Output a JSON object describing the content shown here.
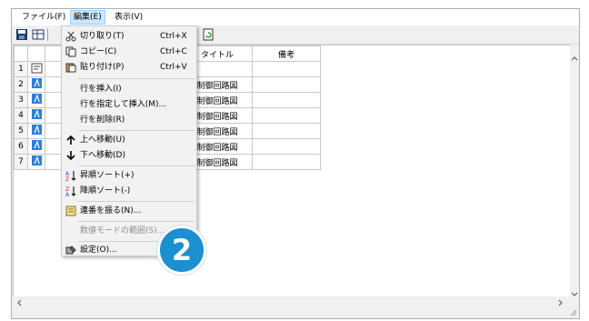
{
  "menubar": {
    "file": "ファイル(F)",
    "edit": "編集(E)",
    "view": "表示(V)"
  },
  "grid": {
    "headers": [
      "タイトル",
      "備考"
    ],
    "rows": [
      {
        "num": "1",
        "title": ""
      },
      {
        "num": "2",
        "title": "制御回路図"
      },
      {
        "num": "3",
        "title": "制御回路図"
      },
      {
        "num": "4",
        "title": "制御回路図"
      },
      {
        "num": "5",
        "title": "制御回路図"
      },
      {
        "num": "6",
        "title": "制御回路図"
      },
      {
        "num": "7",
        "title": "制御回路図"
      }
    ]
  },
  "edit_menu": {
    "cut": {
      "label": "切り取り(T)",
      "shortcut": "Ctrl+X",
      "icon": "scissors-icon"
    },
    "copy": {
      "label": "コピー(C)",
      "shortcut": "Ctrl+C",
      "icon": "copy-icon"
    },
    "paste": {
      "label": "貼り付け(P)",
      "shortcut": "Ctrl+V",
      "icon": "paste-icon"
    },
    "insert_row": {
      "label": "行を挿入(I)"
    },
    "insert_row_at": {
      "label": "行を指定して挿入(M)..."
    },
    "delete_row": {
      "label": "行を削除(R)"
    },
    "move_up": {
      "label": "上へ移動(U)",
      "icon": "arrow-up-icon"
    },
    "move_down": {
      "label": "下へ移動(D)",
      "icon": "arrow-down-icon"
    },
    "sort_asc": {
      "label": "昇順ソート(+)",
      "icon": "sort-ascending-icon"
    },
    "sort_desc": {
      "label": "降順ソート(-)",
      "icon": "sort-descending-icon"
    },
    "numbering": {
      "label": "連番を振る(N)...",
      "icon": "numbering-icon"
    },
    "numeric_range": {
      "label": "数値モードの範囲(S)..."
    },
    "settings": {
      "label": "設定(O)...",
      "icon": "settings-icon"
    }
  },
  "badge": {
    "number": "2"
  },
  "colors": {
    "badge": "#1b8fd0",
    "menu_highlight": "#cce8ff",
    "row_icon": "#2f7fd8"
  }
}
